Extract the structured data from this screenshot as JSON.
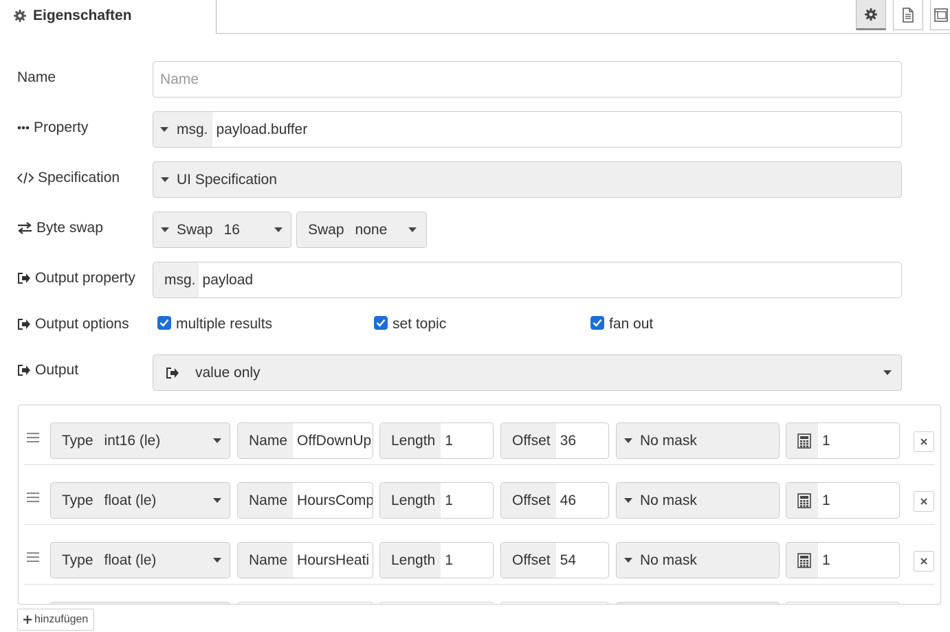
{
  "tab": {
    "title": "Eigenschaften",
    "icon": "gear-icon"
  },
  "toolbar": {
    "buttons": [
      {
        "icon": "gear-icon",
        "selected": true
      },
      {
        "icon": "document-icon",
        "selected": false
      },
      {
        "icon": "layout-icon",
        "selected": false
      }
    ]
  },
  "form": {
    "name": {
      "label": "Name",
      "placeholder": "Name",
      "value": ""
    },
    "property": {
      "label": "Property",
      "prefix": "msg.",
      "value": "payload.buffer"
    },
    "specification": {
      "label": "Specification",
      "value": "UI Specification"
    },
    "byte_swap": {
      "label": "Byte swap",
      "swap1": {
        "label": "Swap",
        "value": "16"
      },
      "swap2": {
        "label": "Swap",
        "value": "none"
      }
    },
    "output_property": {
      "label": "Output property",
      "prefix": "msg.",
      "value": "payload"
    },
    "output_options": {
      "label": "Output options",
      "options": [
        {
          "label": "multiple results",
          "checked": true
        },
        {
          "label": "set topic",
          "checked": true
        },
        {
          "label": "fan out",
          "checked": true
        }
      ]
    },
    "output": {
      "label": "Output",
      "value": "value only"
    }
  },
  "rows": [
    {
      "type_label": "Type",
      "type": "int16 (le)",
      "name_label": "Name",
      "name": "OffDownUp",
      "length_label": "Length",
      "length": "1",
      "offset_label": "Offset",
      "offset": "36",
      "mask": "No mask",
      "scale": "1"
    },
    {
      "type_label": "Type",
      "type": "float (le)",
      "name_label": "Name",
      "name": "HoursComp",
      "length_label": "Length",
      "length": "1",
      "offset_label": "Offset",
      "offset": "46",
      "mask": "No mask",
      "scale": "1"
    },
    {
      "type_label": "Type",
      "type": "float (le)",
      "name_label": "Name",
      "name": "HoursHeati",
      "length_label": "Length",
      "length": "1",
      "offset_label": "Offset",
      "offset": "54",
      "mask": "No mask",
      "scale": "1"
    }
  ],
  "add_button": {
    "label": "hinzufügen"
  },
  "colors": {
    "accent": "#1d6ed8",
    "input_bg": "#efefef",
    "border": "#cccccc"
  }
}
